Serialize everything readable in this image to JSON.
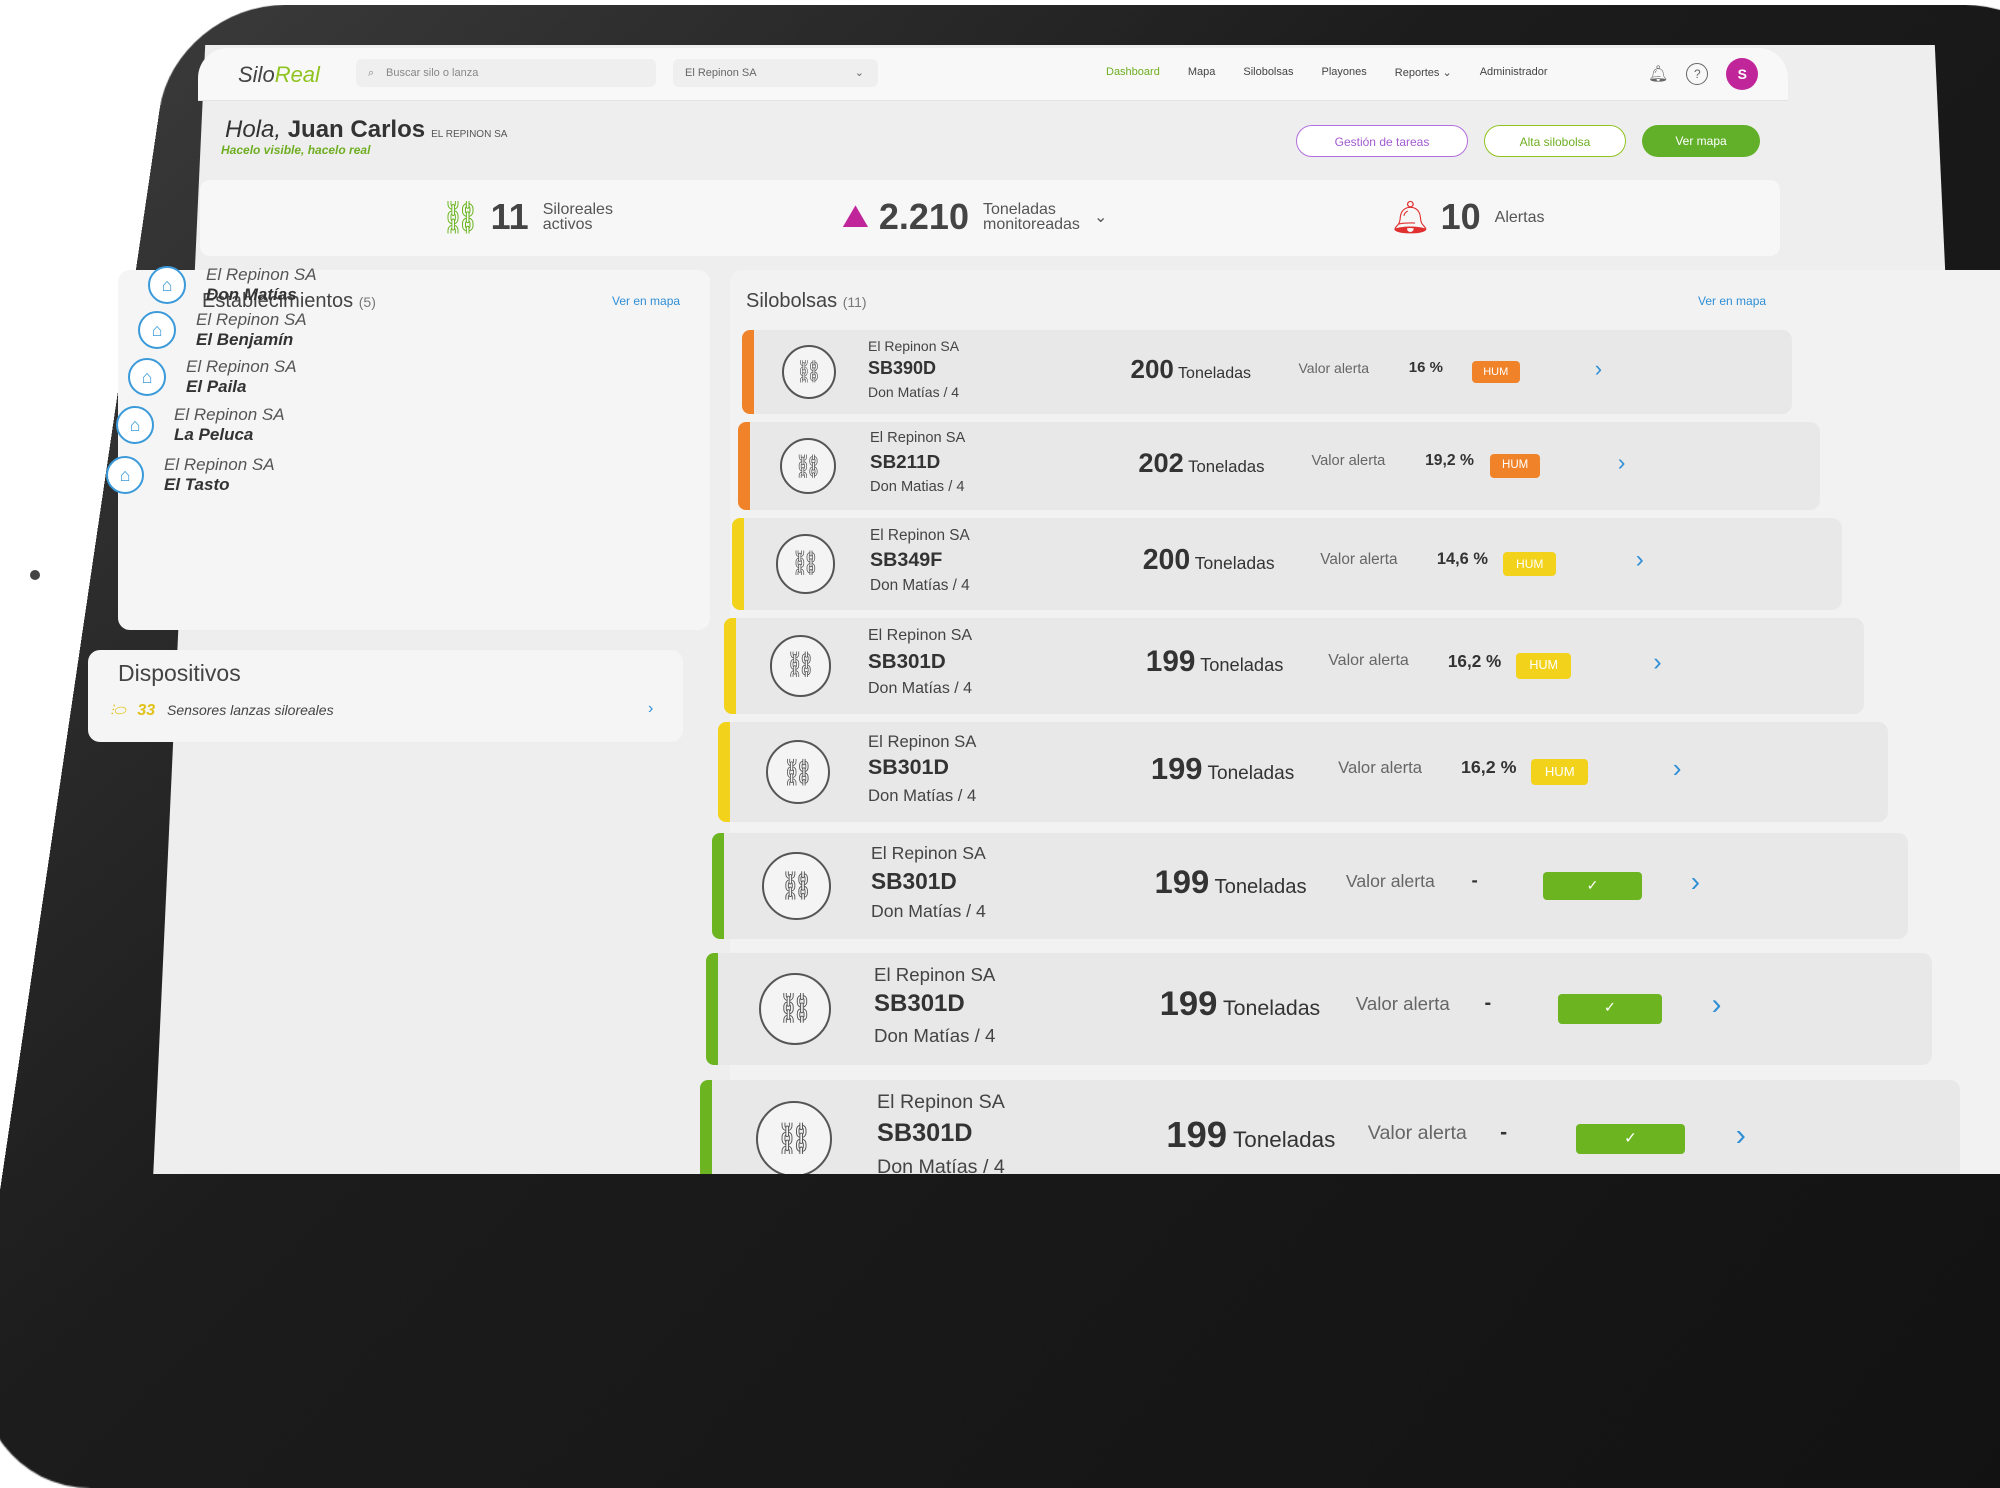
{
  "nav": {
    "logo_a": "Silo",
    "logo_b": "Real",
    "search_placeholder": "Buscar silo o lanza",
    "company_select": "El Repinon SA",
    "links": [
      "Dashboard",
      "Mapa",
      "Silobolsas",
      "Playones",
      "Reportes",
      "Administrador"
    ],
    "active": "Dashboard",
    "avatar": "S"
  },
  "header": {
    "greet": "Hola,",
    "user": "Juan Carlos",
    "company": "EL REPINON SA",
    "tagline": "Hacelo visible, hacelo real",
    "buttons": {
      "tareas": "Gestión de tareas",
      "alta": "Alta silobolsa",
      "mapa": "Ver mapa"
    }
  },
  "stats": {
    "silo_num": "11",
    "silo_label1": "Siloreales",
    "silo_label2": "activos",
    "ton_num": "2.210",
    "ton_label1": "Toneladas",
    "ton_label2": "monitoreadas",
    "alert_num": "10",
    "alert_label": "Alertas"
  },
  "establecimientos": {
    "title": "Establecimientos",
    "count": "(5)",
    "link": "Ver en mapa",
    "items": [
      {
        "company": "El Repinon SA",
        "name": "Don Matías"
      },
      {
        "company": "El Repinon SA",
        "name": "El Benjamín"
      },
      {
        "company": "El Repinon SA",
        "name": "El Paila"
      },
      {
        "company": "El Repinon SA",
        "name": "La Peluca"
      },
      {
        "company": "El Repinon SA",
        "name": "El Tasto"
      }
    ]
  },
  "dispositivos": {
    "title": "Dispositivos",
    "count": "33",
    "label": "Sensores lanzas siloreales"
  },
  "silobolsas": {
    "title": "Silobolsas",
    "count": "(11)",
    "link": "Ver en mapa",
    "rows": [
      {
        "company": "El Repinon SA",
        "code": "SB390D",
        "loc": "Don Matías / 4",
        "tons": "200",
        "unit": "Toneladas",
        "va": "Valor alerta",
        "pct": "16 %",
        "badge": "HUM",
        "color": "#f0832a"
      },
      {
        "company": "El Repinon SA",
        "code": "SB211D",
        "loc": "Don Matias / 4",
        "tons": "202",
        "unit": "Toneladas",
        "va": "Valor alerta",
        "pct": "19,2 %",
        "badge": "HUM",
        "color": "#f0832a"
      },
      {
        "company": "El Repinon SA",
        "code": "SB349F",
        "loc": "Don Matías / 4",
        "tons": "200",
        "unit": "Toneladas",
        "va": "Valor alerta",
        "pct": "14,6 %",
        "badge": "HUM",
        "color": "#f2d21a"
      },
      {
        "company": "El Repinon SA",
        "code": "SB301D",
        "loc": "Don Matías / 4",
        "tons": "199",
        "unit": "Toneladas",
        "va": "Valor alerta",
        "pct": "16,2 %",
        "badge": "HUM",
        "color": "#f2d21a"
      },
      {
        "company": "El Repinon SA",
        "code": "SB301D",
        "loc": "Don Matías / 4",
        "tons": "199",
        "unit": "Toneladas",
        "va": "Valor alerta",
        "pct": "16,2 %",
        "badge": "HUM",
        "color": "#f2d21a"
      },
      {
        "company": "El Repinon SA",
        "code": "SB301D",
        "loc": "Don Matías / 4",
        "tons": "199",
        "unit": "Toneladas",
        "va": "Valor alerta",
        "pct": "-",
        "badge": "✓",
        "color": "#6cb521"
      },
      {
        "company": "El Repinon SA",
        "code": "SB301D",
        "loc": "Don Matías / 4",
        "tons": "199",
        "unit": "Toneladas",
        "va": "Valor alerta",
        "pct": "-",
        "badge": "✓",
        "color": "#6cb521"
      },
      {
        "company": "El Repinon SA",
        "code": "SB301D",
        "loc": "Don Matías / 4",
        "tons": "199",
        "unit": "Toneladas",
        "va": "Valor alerta",
        "pct": "-",
        "badge": "✓",
        "color": "#6cb521"
      }
    ]
  }
}
